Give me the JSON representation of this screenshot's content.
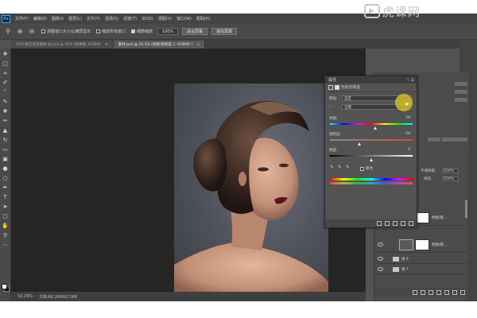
{
  "app": {
    "logo": "Ps"
  },
  "menu": [
    "文件(F)",
    "编辑(E)",
    "图像(I)",
    "图层(L)",
    "文字(Y)",
    "选择(S)",
    "滤镜(T)",
    "3D(D)",
    "视图(V)",
    "窗口(W)",
    "帮助(H)"
  ],
  "watermark": {
    "text": "虎课网",
    "icon": "play-logo-icon"
  },
  "options": {
    "resize_windows": "调整窗口大小以满屏显示",
    "zoom_all": "缩放所有窗口",
    "scrubby_zoom": "细微缩放",
    "zoom_value": "100%",
    "fit_screen": "适合屏幕",
    "fill_screen": "填充屏幕"
  },
  "tabs": [
    {
      "label": "2015真实发型模板-副.psd @ 45% (效果图, RGB/8)",
      "active": false
    },
    {
      "label": "素材.psd @ 16.3% (色相/饱和度 1, RGB/8) *",
      "active": true
    }
  ],
  "status": {
    "zoom": "16.29%",
    "doc": "文档:66.2M/607.9M"
  },
  "properties": {
    "title": "属性",
    "panel_name": "色相/饱和度",
    "preset_label": "预设:",
    "preset_value": "自定",
    "channel_value": "全图",
    "hue_label": "色相:",
    "hue_value": "18",
    "saturation_label": "饱和度:",
    "saturation_value": "-28",
    "lightness_label": "明度:",
    "lightness_value": "0",
    "colorize_label": "着色",
    "colorize_checked": false,
    "hue_slider": 0.55,
    "saturation_slider": 0.36,
    "lightness_slider": 0.5
  },
  "layers": {
    "opacity_label": "不透明度:",
    "opacity": "100%",
    "fill_label": "填充:",
    "fill": "100%",
    "lock_label": "锁定:",
    "rows": [
      {
        "name": "色相/饱...",
        "type": "adjustment"
      },
      {
        "name": "色相/饱...",
        "type": "adjustment"
      },
      {
        "name": "组 6",
        "type": "group"
      },
      {
        "name": "组 7",
        "type": "group"
      }
    ]
  }
}
